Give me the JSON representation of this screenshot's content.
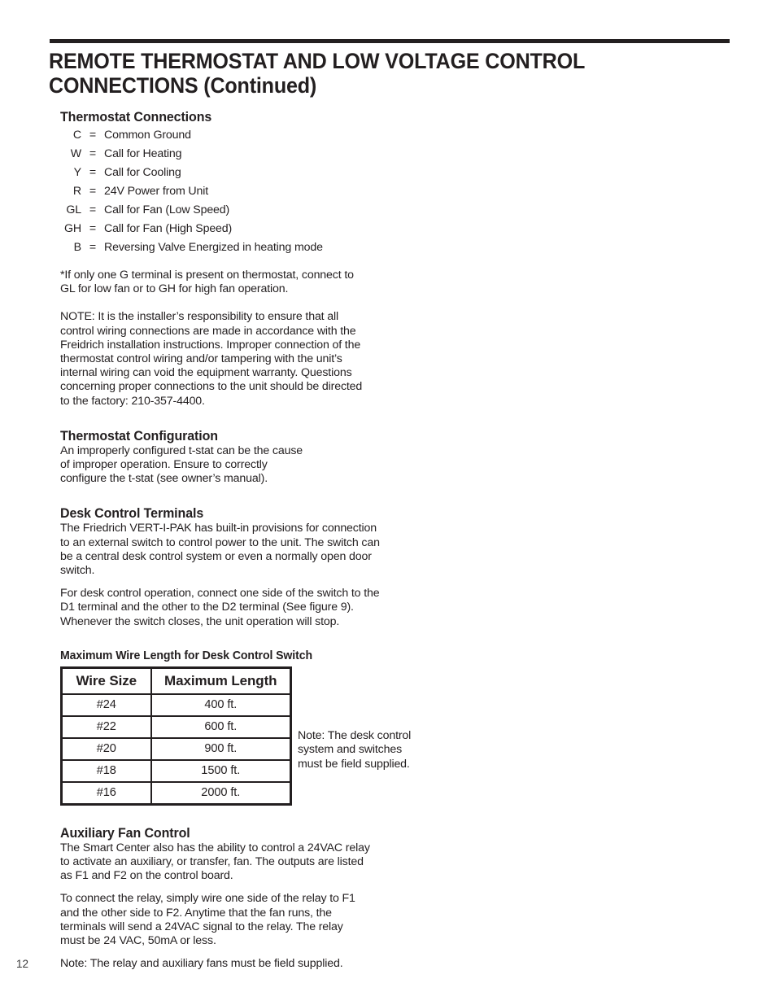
{
  "page": {
    "number": "12",
    "text_color": "#231f20",
    "background": "#ffffff"
  },
  "title": {
    "line1": "REMOTE THERMOSTAT AND LOW VOLTAGE CONTROL",
    "line2": "CONNECTIONS (Continued)"
  },
  "sections": {
    "thermostat_connections": {
      "heading": "Thermostat Connections",
      "terminals": [
        {
          "key": "C",
          "eq": "=",
          "desc": "Common Ground"
        },
        {
          "key": "W",
          "eq": "=",
          "desc": "Call for Heating"
        },
        {
          "key": "Y",
          "eq": "=",
          "desc": "Call for Cooling"
        },
        {
          "key": "R",
          "eq": "=",
          "desc": "24V Power from Unit"
        },
        {
          "key": "GL",
          "eq": "=",
          "desc": "Call for Fan (Low Speed)"
        },
        {
          "key": "GH",
          "eq": "=",
          "desc": "Call for Fan (High Speed)"
        },
        {
          "key": "B",
          "eq": "=",
          "desc": "Reversing Valve Energized in heating mode"
        }
      ],
      "footnote": "*If only one G terminal is present on thermostat, connect to GL for low fan or to GH for high fan operation.",
      "note": "NOTE: It is the installer’s responsibility to ensure that all control wiring connections are made in accordance with the Freidrich installation instructions.  Improper connection of the thermostat control wiring and/or tampering with the unit’s internal wiring can void the equipment warranty. Questions concerning proper connections to the unit should be directed to the factory: 210-357-4400."
    },
    "thermostat_configuration": {
      "heading": "Thermostat Configuration",
      "paragraph": "An improperly configured t-stat can be the cause of improper operation. Ensure to correctly configure the t-stat (see owner’s manual)."
    },
    "desk_control_terminals": {
      "heading": "Desk Control Terminals",
      "paragraph1": "The Friedrich VERT-I-PAK has built-in provisions for connection to an external switch to control power to the unit. The switch can be a central desk control system or even a normally open door switch.",
      "paragraph2": "For desk control operation, connect one side of the switch to the D1 terminal and the other to the D2 terminal (See figure 9). Whenever the switch closes, the unit operation will stop."
    },
    "wire_length": {
      "heading": "Maximum Wire Length for Desk Control Switch",
      "table": {
        "columns": [
          "Wire Size",
          "Maximum Length"
        ],
        "rows": [
          [
            "#24",
            "400 ft."
          ],
          [
            "#22",
            "600 ft."
          ],
          [
            "#20",
            "900 ft."
          ],
          [
            "#18",
            "1500 ft."
          ],
          [
            "#16",
            "2000 ft."
          ]
        ]
      },
      "side_note": "Note: The desk control system and switches must be field supplied."
    },
    "auxiliary_fan_control": {
      "heading": "Auxiliary Fan Control",
      "paragraph1": "The Smart Center also has the ability to control a 24VAC relay to activate an auxiliary, or transfer, fan. The outputs are listed as F1 and F2 on the control board.",
      "paragraph2": "To connect the relay, simply wire one side of the relay to F1 and the other side to F2. Anytime that the fan runs, the terminals will send a 24VAC signal to the relay. The relay must be 24 VAC, 50mA or less.",
      "note": "Note: The relay and auxiliary fans must be field supplied."
    }
  }
}
